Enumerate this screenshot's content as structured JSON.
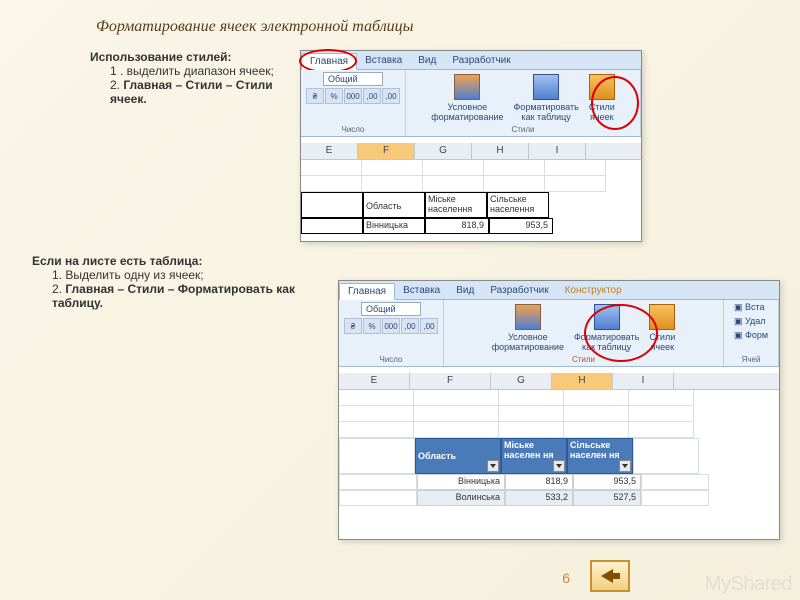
{
  "title": "Форматирование ячеек электронной таблицы",
  "sec1": {
    "heading": "Использование стилей:",
    "step1": "1 . выделить диапазон ячеек;",
    "step2_pre": "2. ",
    "step2_path": "Главная – Стили – Стили ячеек."
  },
  "sec2": {
    "heading": "Если на листе есть таблица:",
    "step1": "1. Выделить одну из ячеек;",
    "step2_pre": "2. ",
    "step2_path": "Главная – Стили – Форматировать как таблицу."
  },
  "ribbon": {
    "tabs1": [
      "Главная",
      "Вставка",
      "Вид",
      "Разработчик"
    ],
    "tabs2": [
      "Главная",
      "Вставка",
      "Вид",
      "Разработчик",
      "Конструктор"
    ],
    "format_general": "Общий",
    "num_symbols": [
      "%",
      "000",
      ",00",
      ",00"
    ],
    "group_number": "Число",
    "group_styles": "Стили",
    "group_cells": "Ячей",
    "btn_cond": "Условное\nформатирование",
    "btn_table": "Форматировать\nкак таблицу",
    "btn_styles": "Стили\nячеек",
    "side_insert": "Вста",
    "side_delete": "Удал",
    "side_format": "Форм"
  },
  "cols": [
    "E",
    "F",
    "G",
    "H",
    "I"
  ],
  "table1": {
    "h1": "Область",
    "h2": "Міське\nнаселення",
    "h3": "Сільське\nнаселення",
    "r1": [
      "Вінницька",
      "818,9",
      "953,5"
    ]
  },
  "table2": {
    "h1": "Область",
    "h2": "Міське населен ня",
    "h3": "Сільське населен ня",
    "rows": [
      [
        "Вінницька",
        "818,9",
        "953,5"
      ],
      [
        "Волинська",
        "533,2",
        "527,5"
      ]
    ]
  },
  "page": "6",
  "watermark": "MyShared"
}
